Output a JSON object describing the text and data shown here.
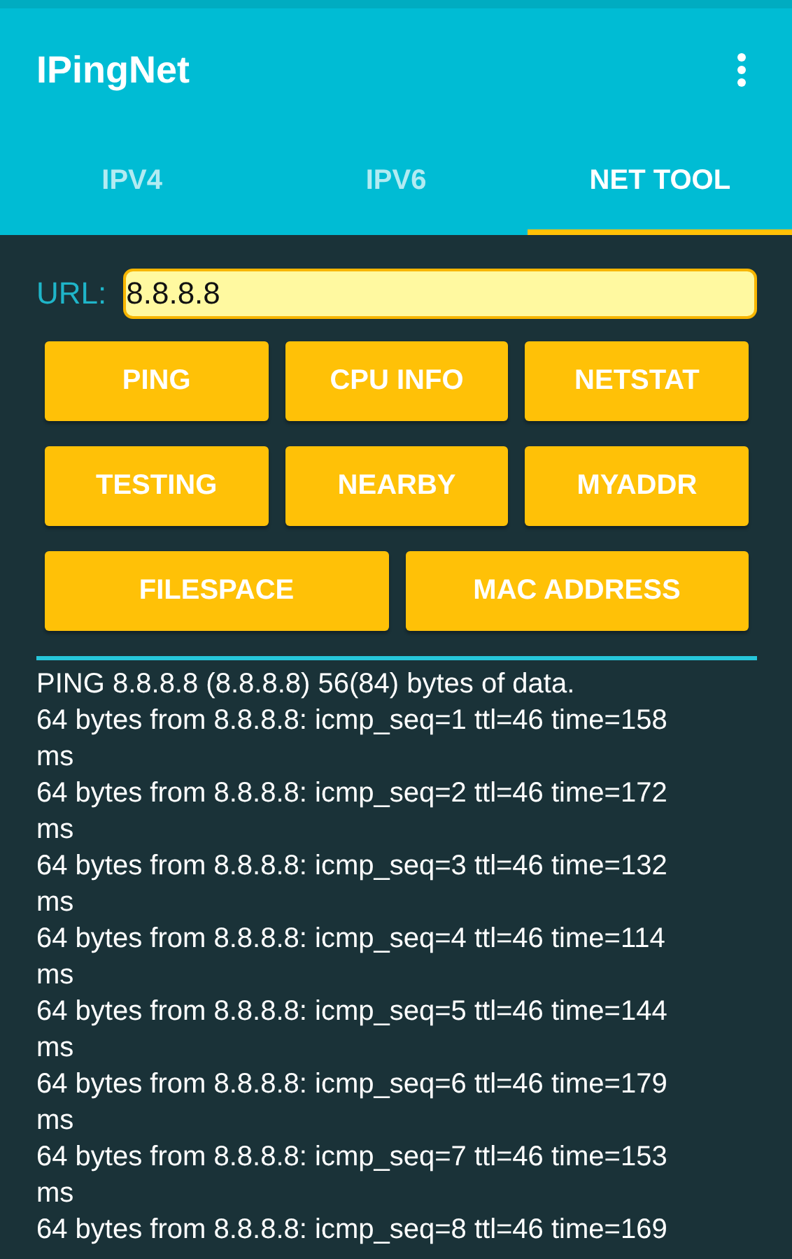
{
  "app_bar": {
    "title": "IPingNet"
  },
  "tabs": [
    {
      "label": "IPV4",
      "selected": false
    },
    {
      "label": "IPV6",
      "selected": false
    },
    {
      "label": "NET TOOL",
      "selected": true
    }
  ],
  "url_field": {
    "label": "URL:",
    "value": "8.8.8.8"
  },
  "button_rows": [
    [
      "PING",
      "CPU INFO",
      "NETSTAT"
    ],
    [
      "TESTING",
      "NEARBY",
      "MYADDR"
    ],
    [
      "FILESPACE",
      "MAC ADDRESS"
    ]
  ],
  "output_lines": [
    "PING 8.8.8.8 (8.8.8.8) 56(84) bytes of data.",
    "64 bytes from 8.8.8.8: icmp_seq=1 ttl=46 time=158",
    "ms",
    "64 bytes from 8.8.8.8: icmp_seq=2 ttl=46 time=172",
    "ms",
    "64 bytes from 8.8.8.8: icmp_seq=3 ttl=46 time=132",
    "ms",
    "64 bytes from 8.8.8.8: icmp_seq=4 ttl=46 time=114",
    "ms",
    "64 bytes from 8.8.8.8: icmp_seq=5 ttl=46 time=144",
    "ms",
    "64 bytes from 8.8.8.8: icmp_seq=6 ttl=46 time=179",
    "ms",
    "64 bytes from 8.8.8.8: icmp_seq=7 ttl=46 time=153",
    "ms",
    "64 bytes from 8.8.8.8: icmp_seq=8 ttl=46 time=169"
  ]
}
